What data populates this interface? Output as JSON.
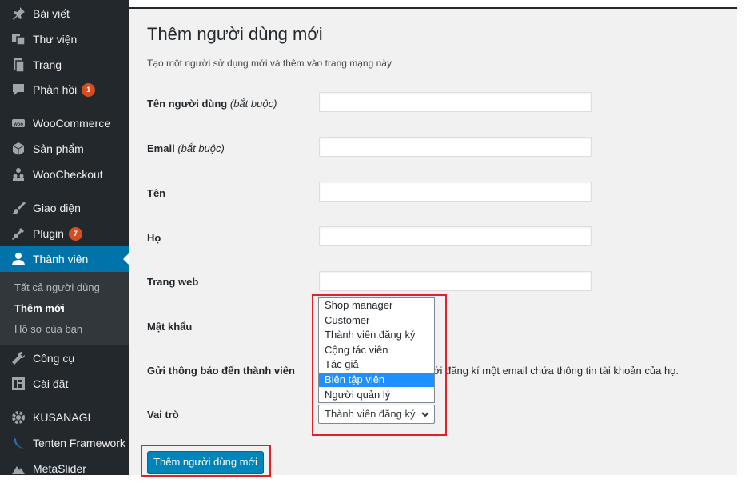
{
  "sidebar": {
    "items": [
      {
        "label": "Bài viết",
        "icon": "pin-icon"
      },
      {
        "label": "Thư viện",
        "icon": "media-icon"
      },
      {
        "label": "Trang",
        "icon": "page-icon"
      },
      {
        "label": "Phản hồi",
        "icon": "comment-icon",
        "badge": "1"
      },
      {
        "label": "WooCommerce",
        "icon": "woo-icon"
      },
      {
        "label": "Sản phẩm",
        "icon": "box-icon"
      },
      {
        "label": "WooCheckout",
        "icon": "people-icon"
      },
      {
        "label": "Giao diện",
        "icon": "brush-icon"
      },
      {
        "label": "Plugin",
        "icon": "plug-icon",
        "badge": "7"
      },
      {
        "label": "Thành viên",
        "icon": "user-icon"
      },
      {
        "label": "Công cụ",
        "icon": "wrench-icon"
      },
      {
        "label": "Cài đặt",
        "icon": "settings-icon"
      },
      {
        "label": "KUSANAGI",
        "icon": "gear-icon"
      },
      {
        "label": "Tenten Framework",
        "icon": "swirl-icon"
      },
      {
        "label": "MetaSlider",
        "icon": "mountain-icon"
      }
    ],
    "submenu": [
      "Tất cả người dùng",
      "Thêm mới",
      "Hồ sơ của bạn"
    ]
  },
  "page": {
    "title": "Thêm người dùng mới",
    "description": "Tạo một người sử dụng mới và thêm vào trang mạng này."
  },
  "form": {
    "username_label": "Tên người dùng",
    "email_label": "Email",
    "required": "(bắt buộc)",
    "firstname_label": "Tên",
    "lastname_label": "Họ",
    "website_label": "Trang web",
    "password_label": "Mật khẩu",
    "notify_label": "Gửi thông báo đến thành viên",
    "notify_text": "ới đăng kí một email chứa thông tin tài khoản của họ.",
    "role_label": "Vai trò",
    "role_selected": "Thành viên đăng ký",
    "role_options": [
      "Shop manager",
      "Customer",
      "Thành viên đăng ký",
      "Cộng tác viên",
      "Tác giả",
      "Biên tập viên",
      "Người quản lý"
    ],
    "role_highlighted": "Biên tập viên",
    "submit_label": "Thêm người dùng mới"
  },
  "colors": {
    "sidebar_bg": "#23282d",
    "active_blue": "#0073aa",
    "button_blue": "#0085ba",
    "highlight_red": "#e0202a",
    "option_selected": "#1e90ff",
    "badge_orange": "#d54e21"
  }
}
